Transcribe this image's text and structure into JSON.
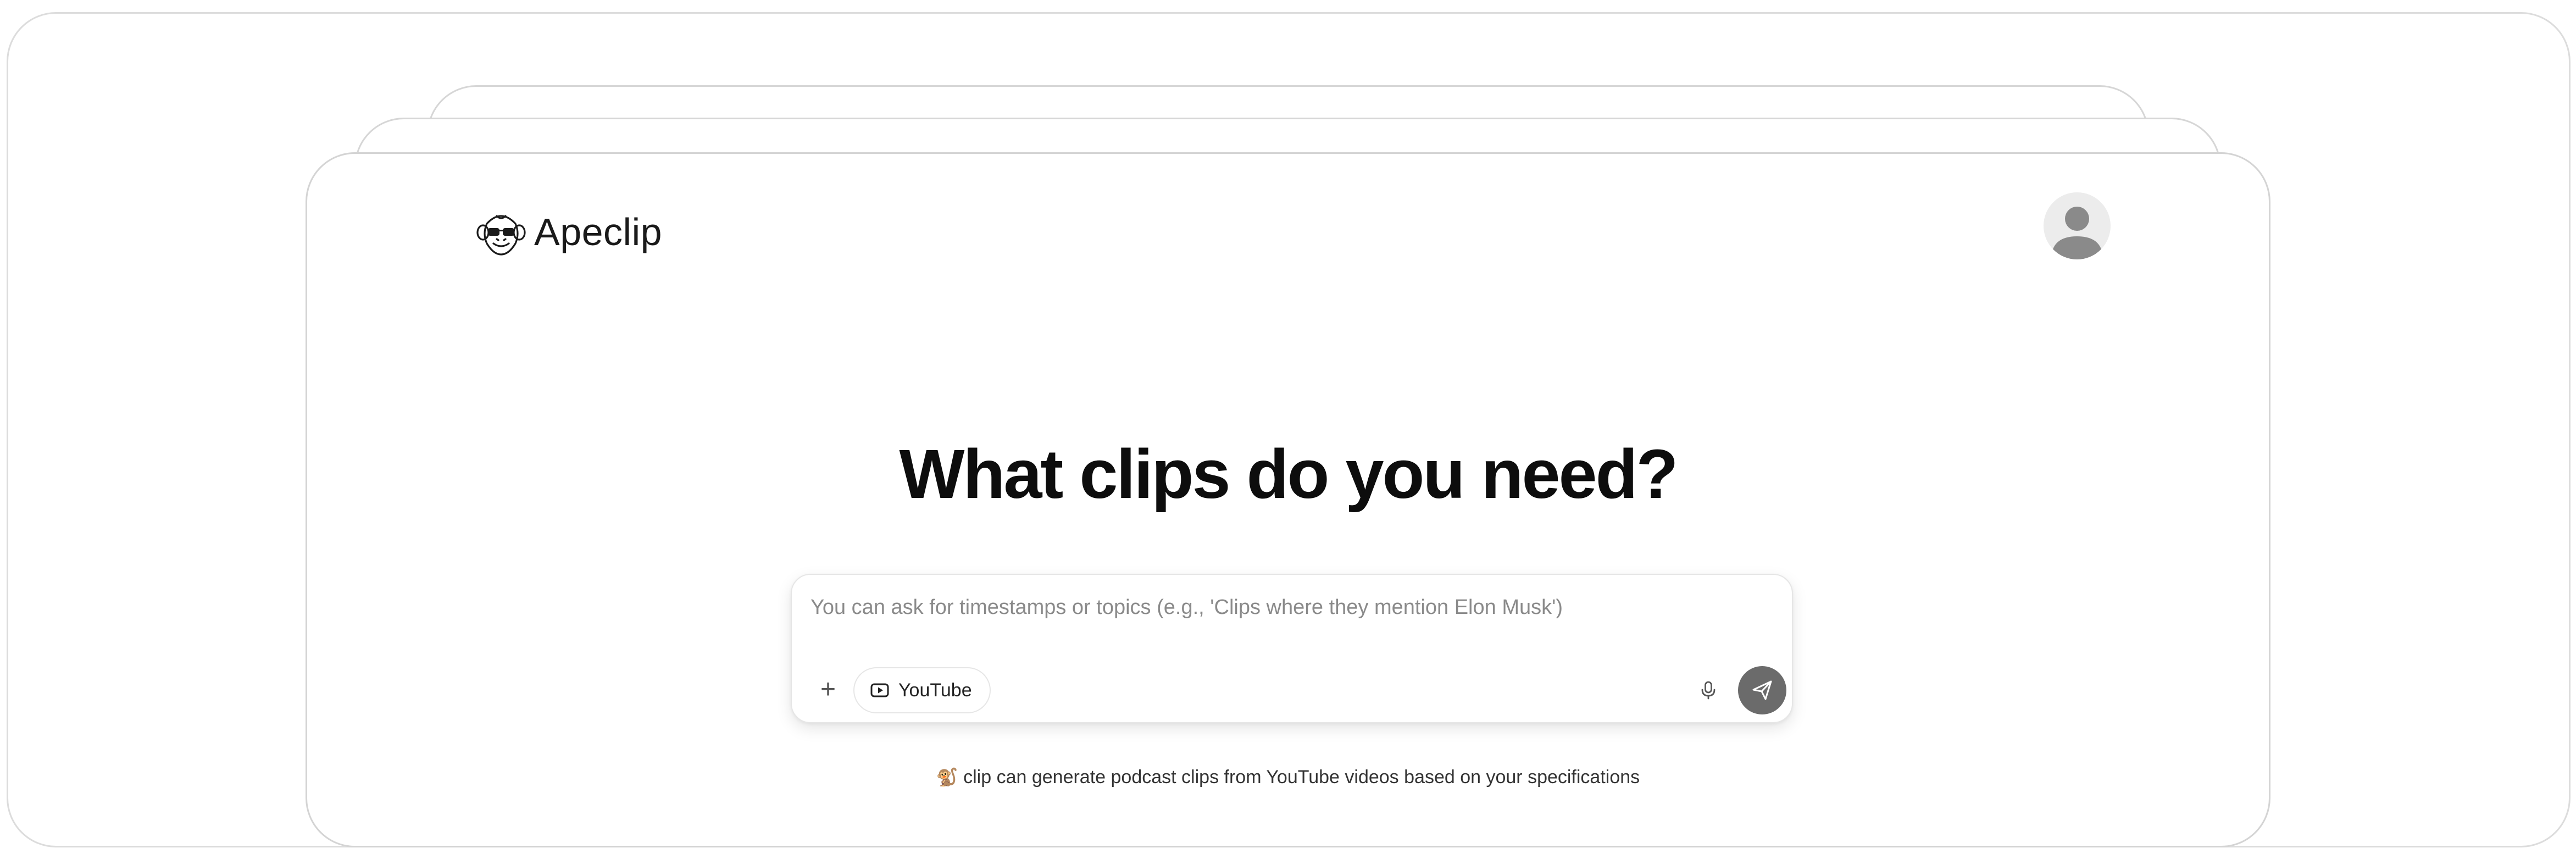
{
  "brand": {
    "name": "Apeclip",
    "logo_icon": "monkey-sunglasses-icon"
  },
  "user": {
    "avatar_icon": "user-avatar-icon"
  },
  "main": {
    "headline": "What clips do you need?"
  },
  "composer": {
    "value": "",
    "placeholder": "You can ask for timestamps or topics (e.g., 'Clips where they mention Elon Musk')",
    "add_label": "+",
    "add_icon": "plus-icon",
    "source_chip": {
      "label": "YouTube",
      "icon": "play-video-icon"
    },
    "mic_icon": "microphone-icon",
    "send_icon": "send-icon"
  },
  "footer": {
    "glyph": "🐒",
    "text": "clip can generate podcast clips from YouTube videos based on your specifications"
  },
  "colors": {
    "send_button": "#6b6b6b",
    "avatar_bg": "#ececec",
    "avatar_fg": "#8a8a8a",
    "border": "#d4d4d4"
  }
}
